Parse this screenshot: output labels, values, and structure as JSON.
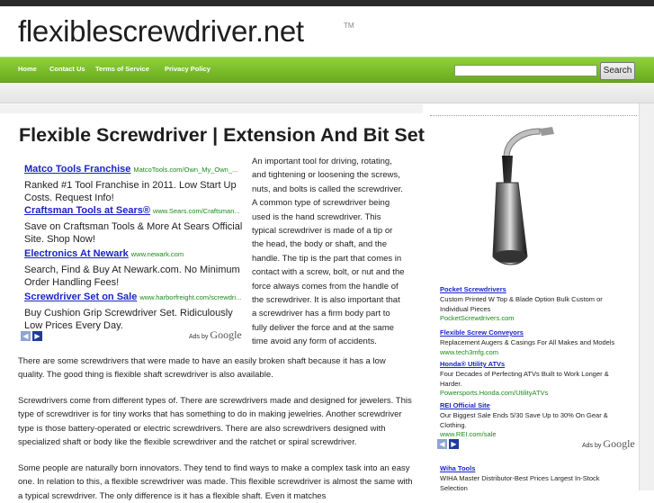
{
  "header": {
    "logo": "flexiblescrewdriver.net",
    "tm": "TM"
  },
  "nav": {
    "items": [
      "Home",
      "Contact Us",
      "Terms of Service",
      "Privacy Policy"
    ]
  },
  "search": {
    "placeholder": "",
    "button_label": "Search"
  },
  "main": {
    "title": "Flexible Screwdriver | Extension And Bit Set",
    "ads": [
      {
        "title": "Matco Tools Franchise",
        "url": "MatcoTools.com/Own_My_Own_...",
        "desc": "Ranked #1 Tool Franchise in 2011. Low Start Up Costs. Request Info!"
      },
      {
        "title": "Craftsman Tools at Sears®",
        "url": "www.Sears.com/Craftsman...",
        "desc": "Save on Craftsman Tools & More At Sears Official Site. Shop Now!"
      },
      {
        "title": "Electronics At Newark",
        "url": "www.newark.com",
        "desc": "Search, Find & Buy At Newark.com. No Minimum Order Handling Fees!"
      },
      {
        "title": "Screwdriver Set on Sale",
        "url": "www.harborfreight.com/screwdri...",
        "desc": "Buy Cushion Grip Screwdriver Set. Ridiculously Low Prices Every Day."
      }
    ],
    "ads_by": "Ads by",
    "ads_brand": "Google",
    "intro": "An important tool for driving, rotating, and tightening or loosening the screws, nuts, and bolts is called the screwdriver. A common type of screwdriver being used is the hand screwdriver. This typical screwdriver is made of a tip or the head, the body or shaft, and the handle. The tip is the part that comes in contact with a screw, bolt, or nut and the force always comes from the handle of the screwdriver. It is also important that a screwdriver has a firm body part to fully deliver the force and at the same time avoid any form of accidents.",
    "paragraphs": [
      "There are some screwdrivers that were made to have an easily broken shaft because it has a low quality. The good thing is flexible shaft screwdriver is also available.",
      "Screwdrivers come from different types of. There are screwdrivers made and designed for jewelers. This type of screwdriver is for tiny works that has something to do in making jewelries. Another screwdriver type is those battery-operated or electric screwdrivers. There are also screwdrivers designed with specialized shaft or body like the flexible screwdriver and the ratchet or spiral screwdriver.",
      "Some people are naturally born innovators. They tend to find ways to make a complex task into an easy one. In relation to this, a flexible screwdriver was made. This flexible screwdriver is almost the same with a typical screwdriver. The only difference is it has a flexible shaft. Even it matches"
    ]
  },
  "sidebar": {
    "ads": [
      {
        "title": "Pocket Screwdrivers",
        "desc": "Custom Printed W Top & Blade Option Bulk Custom or Individual Pieces",
        "url": "PocketScrewdrivers.com"
      },
      {
        "title": "Flexible Screw Conveyors",
        "desc": "Replacement Augers & Casings For All Makes and Models",
        "url": "www.tech3mfg.com"
      },
      {
        "title": "Honda® Utility ATVs",
        "desc": "Four Decades of Perfecting ATVs Built to Work Longer & Harder.",
        "url": "Powersports.Honda.com/UtilityATVs"
      },
      {
        "title": "REI Official Site",
        "desc": "Our Biggest Sale Ends 5/30 Save Up to 30% On Gear & Clothing.",
        "url": "www.REI.com/sale"
      },
      {
        "title": "Wiha Tools",
        "desc": "WIHA Master Distributor-Best Prices Largest In-Stock Selection",
        "url": ""
      }
    ],
    "ads_by": "Ads by",
    "ads_brand": "Google"
  }
}
